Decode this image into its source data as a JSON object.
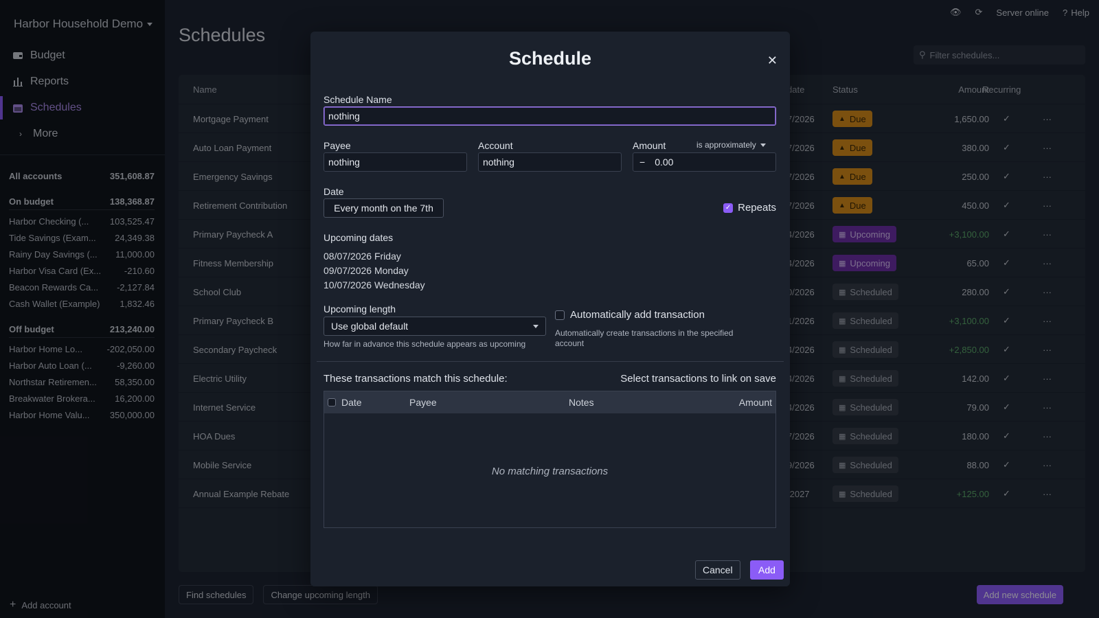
{
  "sidebar": {
    "budget_name": "Harbor Household Demo",
    "nav": [
      {
        "label": "Budget",
        "icon": "wallet-icon"
      },
      {
        "label": "Reports",
        "icon": "bar-chart-icon"
      },
      {
        "label": "Schedules",
        "icon": "calendar-icon"
      },
      {
        "label": "More",
        "icon": "chevron-right-icon"
      }
    ],
    "all_accounts": {
      "label": "All accounts",
      "total": "351,608.87"
    },
    "on_budget": {
      "label": "On budget",
      "total": "138,368.87"
    },
    "on_budget_accounts": [
      {
        "name": "Harbor Checking (...",
        "balance": "103,525.47"
      },
      {
        "name": "Tide Savings (Exam...",
        "balance": "24,349.38"
      },
      {
        "name": "Rainy Day Savings (...",
        "balance": "11,000.00"
      },
      {
        "name": "Harbor Visa Card (Ex...",
        "balance": "-210.60"
      },
      {
        "name": "Beacon Rewards Ca...",
        "balance": "-2,127.84"
      },
      {
        "name": "Cash Wallet (Example)",
        "balance": "1,832.46"
      }
    ],
    "off_budget": {
      "label": "Off budget",
      "total": "213,240.00"
    },
    "off_budget_accounts": [
      {
        "name": "Harbor Home Lo...",
        "balance": "-202,050.00"
      },
      {
        "name": "Harbor Auto Loan (...",
        "balance": "-9,260.00"
      },
      {
        "name": "Northstar Retiremen...",
        "balance": "58,350.00"
      },
      {
        "name": "Breakwater Brokera...",
        "balance": "16,200.00"
      },
      {
        "name": "Harbor Home Valu...",
        "balance": "350,000.00"
      }
    ],
    "add_account": "Add account"
  },
  "topbar": {
    "server": "Server online",
    "help": "Help"
  },
  "page": {
    "title": "Schedules",
    "filter_placeholder": "Filter schedules...",
    "columns": {
      "name": "Name",
      "date": "date",
      "status": "Status",
      "amount": "Amount",
      "recurring": "Recurring"
    },
    "rows": [
      {
        "name": "Mortgage Payment",
        "date": "7/2026",
        "status": "Due",
        "amount": "1,650.00",
        "positive": false
      },
      {
        "name": "Auto Loan Payment",
        "date": "7/2026",
        "status": "Due",
        "amount": "380.00",
        "positive": false
      },
      {
        "name": "Emergency Savings",
        "date": "7/2026",
        "status": "Due",
        "amount": "250.00",
        "positive": false
      },
      {
        "name": "Retirement Contribution",
        "date": "7/2026",
        "status": "Due",
        "amount": "450.00",
        "positive": false
      },
      {
        "name": "Primary Paycheck A",
        "date": "4/2026",
        "status": "Upcoming",
        "amount": "+3,100.00",
        "positive": true
      },
      {
        "name": "Fitness Membership",
        "date": "4/2026",
        "status": "Upcoming",
        "amount": "65.00",
        "positive": false
      },
      {
        "name": "School Club",
        "date": "0/2026",
        "status": "Scheduled",
        "amount": "280.00",
        "positive": false
      },
      {
        "name": "Primary Paycheck B",
        "date": "1/2026",
        "status": "Scheduled",
        "amount": "+3,100.00",
        "positive": true
      },
      {
        "name": "Secondary Paycheck",
        "date": "4/2026",
        "status": "Scheduled",
        "amount": "+2,850.00",
        "positive": true
      },
      {
        "name": "Electric Utility",
        "date": "4/2026",
        "status": "Scheduled",
        "amount": "142.00",
        "positive": false
      },
      {
        "name": "Internet Service",
        "date": "4/2026",
        "status": "Scheduled",
        "amount": "79.00",
        "positive": false
      },
      {
        "name": "HOA Dues",
        "date": "7/2026",
        "status": "Scheduled",
        "amount": "180.00",
        "positive": false
      },
      {
        "name": "Mobile Service",
        "date": "9/2026",
        "status": "Scheduled",
        "amount": "88.00",
        "positive": false
      },
      {
        "name": "Annual Example Rebate",
        "date": "/2027",
        "status": "Scheduled",
        "amount": "+125.00",
        "positive": true
      }
    ],
    "find_schedules": "Find schedules",
    "change_upcoming_length": "Change upcoming length",
    "add_new_schedule": "Add new schedule"
  },
  "modal": {
    "title": "Schedule",
    "schedule_name_label": "Schedule Name",
    "schedule_name_value": "nothing",
    "payee_label": "Payee",
    "payee_value": "nothing",
    "account_label": "Account",
    "account_value": "nothing",
    "amount_label": "Amount",
    "amount_mode": "is approximately",
    "amount_sign": "−",
    "amount_value": "0.00",
    "date_label": "Date",
    "date_value": "Every month on the 7th",
    "repeats_label": "Repeats",
    "upcoming_dates_label": "Upcoming dates",
    "upcoming_dates": [
      "08/07/2026 Friday",
      "09/07/2026 Monday",
      "10/07/2026 Wednesday"
    ],
    "upcoming_length_label": "Upcoming length",
    "upcoming_length_value": "Use global default",
    "upcoming_length_help": "How far in advance this schedule appears as upcoming",
    "auto_add_label": "Automatically add transaction",
    "auto_add_help": "Automatically create transactions in the specified account",
    "match_label": "These transactions match this schedule:",
    "select_label": "Select transactions to link on save",
    "tx_columns": {
      "date": "Date",
      "payee": "Payee",
      "notes": "Notes",
      "amount": "Amount"
    },
    "no_match": "No matching transactions",
    "cancel": "Cancel",
    "add": "Add"
  }
}
